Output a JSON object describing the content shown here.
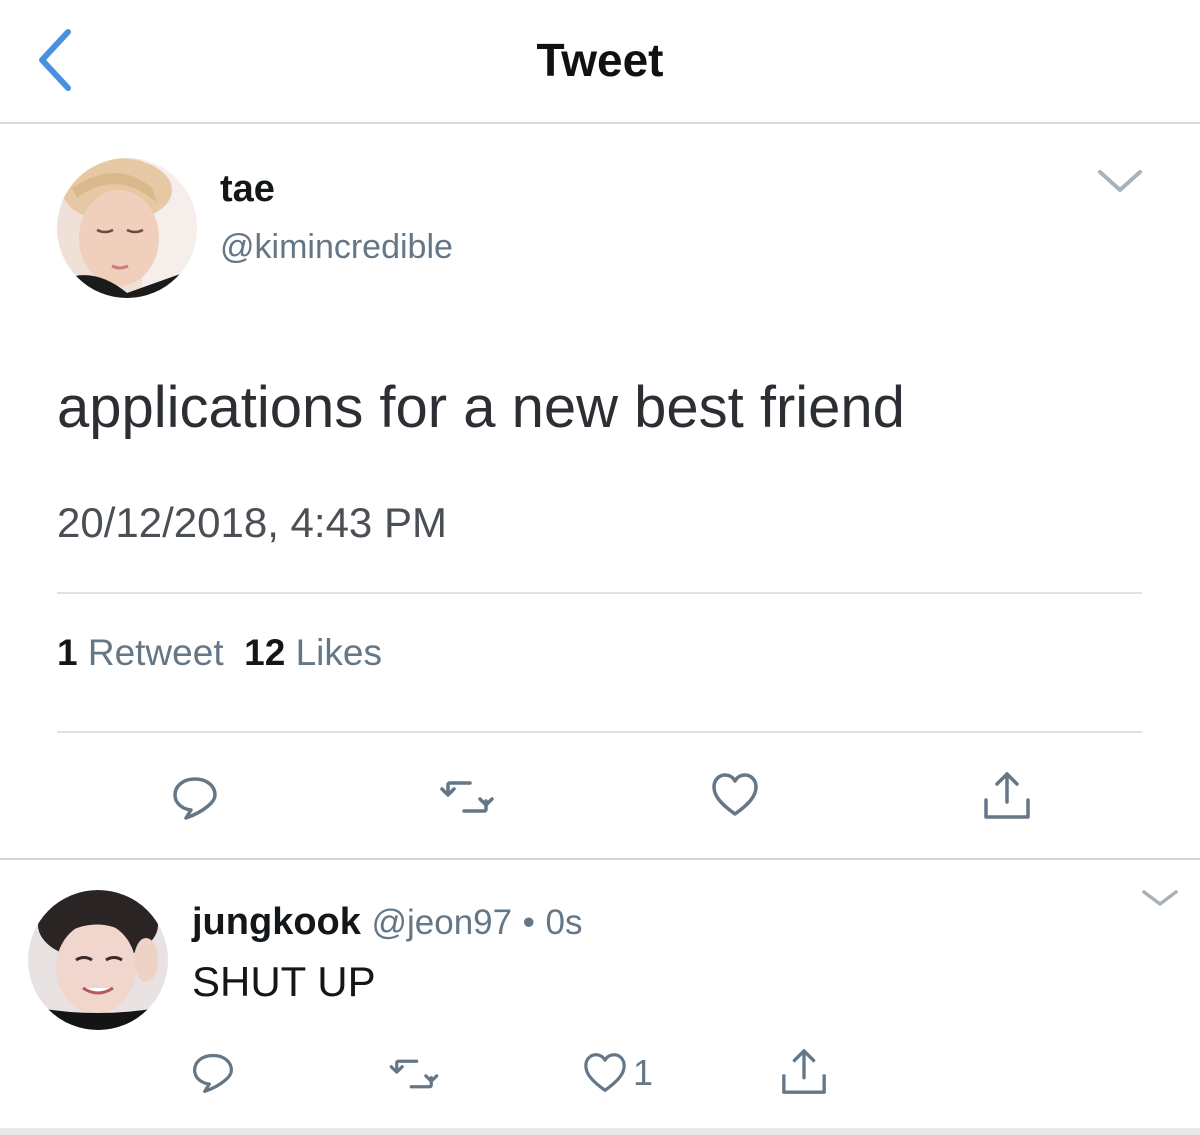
{
  "header": {
    "title": "Tweet",
    "back_icon": "chevron-left-icon",
    "accent": "#4a90e2"
  },
  "tweet": {
    "author_name": "tae",
    "author_handle": "@kimincredible",
    "text": "applications for a new best friend",
    "timestamp": "20/12/2018, 4:43 PM",
    "retweet_count": "1",
    "retweet_label": "Retweet",
    "like_count": "12",
    "like_label": "Likes",
    "actions": [
      "reply-icon",
      "retweet-icon",
      "heart-icon",
      "share-icon"
    ]
  },
  "reply": {
    "author_name": "jungkook",
    "author_handle": "@jeon97",
    "dot": "•",
    "time": "0s",
    "text": "SHUT UP",
    "like_count": "1",
    "actions": [
      "reply-icon",
      "retweet-icon",
      "heart-icon",
      "share-icon"
    ]
  }
}
